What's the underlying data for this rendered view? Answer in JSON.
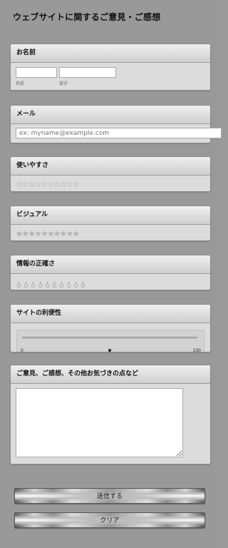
{
  "page_title": "ウェブサイトに関するご意見・ご感想",
  "name_section": {
    "title": "お名前",
    "first_name_label": "名前",
    "last_name_label": "苗字",
    "first_name_value": "",
    "last_name_value": ""
  },
  "email_section": {
    "title": "メール",
    "placeholder": "ex: myname@example.com"
  },
  "usability_section": {
    "title": "使いやすさ",
    "star_count": 10,
    "rating": 0
  },
  "visual_section": {
    "title": "ビジュアル",
    "star_count": 10,
    "rating": 0
  },
  "accuracy_section": {
    "title": "情報の正確さ",
    "bulb_count": 10,
    "rating": 0
  },
  "convenience_section": {
    "title": "サイトの利便性",
    "min_label": "0",
    "max_label": "100",
    "value": 50
  },
  "comments_section": {
    "title": "ご意見、ご感想、その他お気づきの点など",
    "value": ""
  },
  "buttons": {
    "submit_label": "送信する",
    "clear_label": "クリア"
  }
}
